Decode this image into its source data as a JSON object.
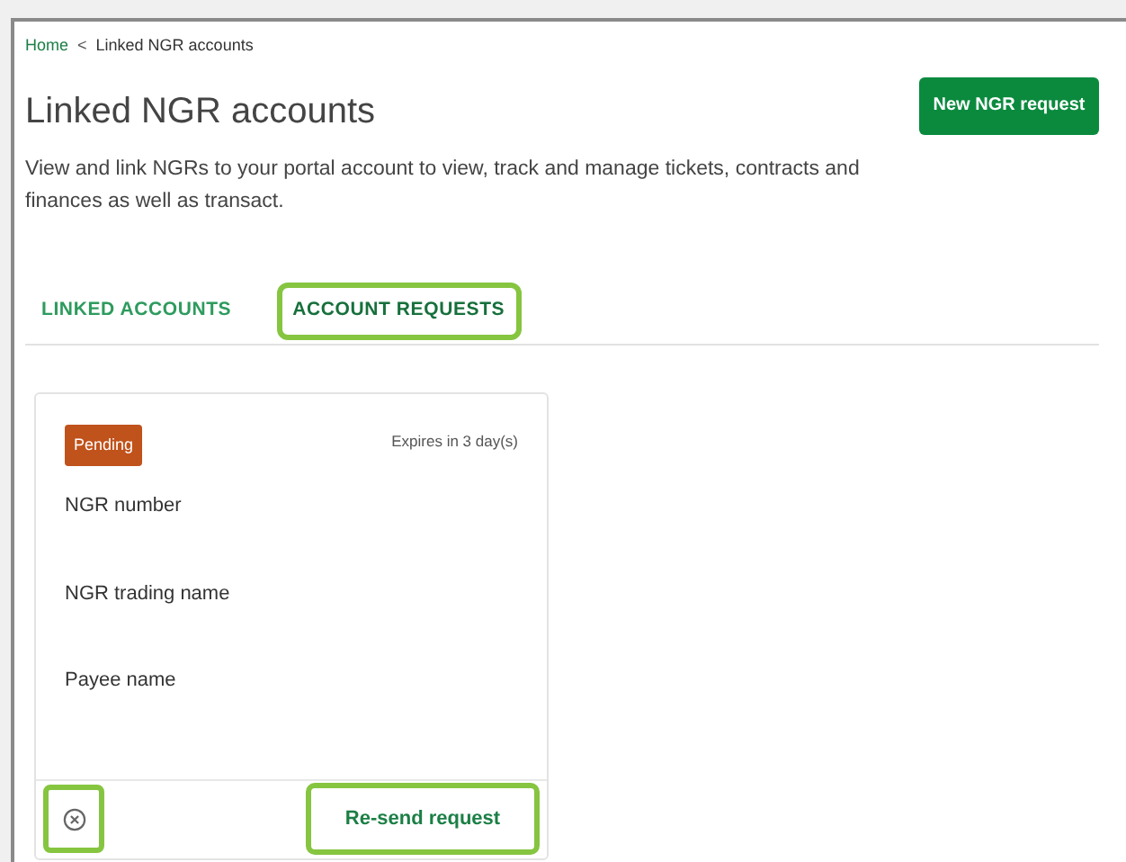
{
  "breadcrumb": {
    "home": "Home",
    "separator": "<",
    "current": "Linked NGR accounts"
  },
  "title": "Linked NGR accounts",
  "new_button": "New NGR request",
  "description": "View and link NGRs to your portal account to view, track and manage tickets, contracts and finances as well as transact.",
  "tabs": [
    {
      "label": "LINKED ACCOUNTS",
      "selected": false,
      "highlighted": false
    },
    {
      "label": "ACCOUNT REQUESTS",
      "selected": true,
      "highlighted": true
    }
  ],
  "request_card": {
    "status": "Pending",
    "expiry": "Expires in 3 day(s)",
    "fields": [
      "NGR number",
      "NGR trading name",
      "Payee name"
    ],
    "cancel_highlighted": true,
    "resend": {
      "label": "Re-send request",
      "highlighted": true
    }
  }
}
